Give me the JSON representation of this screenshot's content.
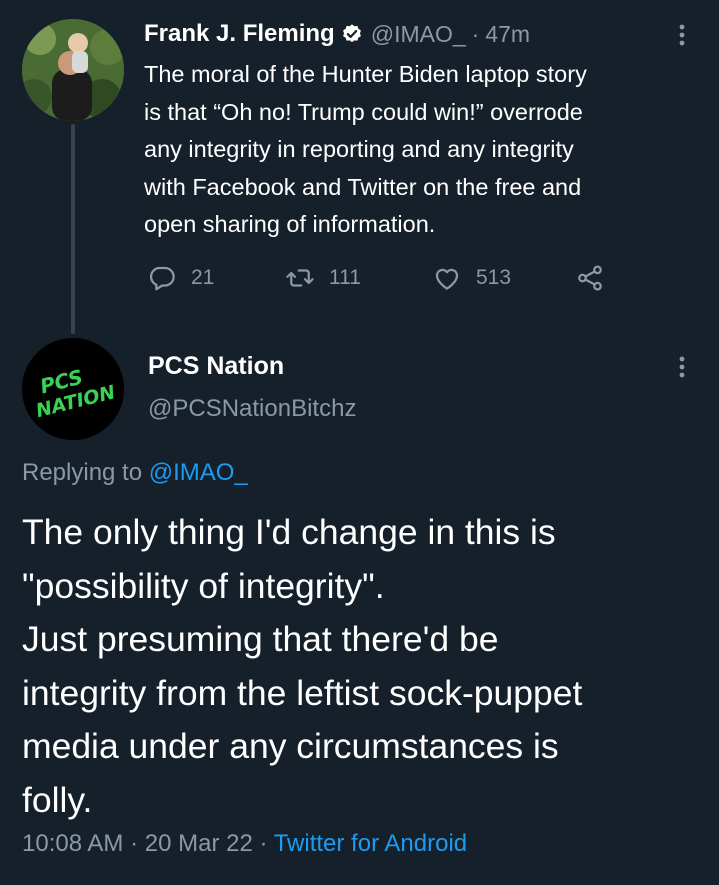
{
  "parent_tweet": {
    "author_name": "Frank J. Fleming",
    "handle": "@IMAO_",
    "separator": "·",
    "time_ago": "47m",
    "text": "The moral of the Hunter Biden laptop story\nis that “Oh no! Trump could win!” overrode\nany integrity in reporting and any integrity\nwith Facebook and Twitter on the free and\nopen sharing of information.",
    "replies": "21",
    "retweets": "111",
    "likes": "513",
    "verified": true
  },
  "reply_tweet": {
    "author_name": "PCS Nation",
    "handle": "@PCSNationBitchz",
    "avatar_text": "PCS NATION",
    "avatar_color": "#39d353",
    "replying_prefix": "Replying to ",
    "replying_to": "@IMAO_",
    "text": "The only thing I'd change in this is\n\"possibility of integrity\".\nJust presuming that there'd be\nintegrity from the leftist sock-puppet\nmedia under any circumstances is\nfolly.",
    "time": "10:08 AM",
    "date": "20 Mar 22",
    "separator": " · ",
    "source": "Twitter for Android"
  },
  "colors": {
    "background": "#15202b",
    "secondary_text": "#8b98a5",
    "link": "#1d9bf0",
    "thread_line": "#38444d"
  },
  "icons": [
    "verified-badge-icon",
    "more-options-icon",
    "reply-icon",
    "retweet-icon",
    "like-icon",
    "share-icon"
  ]
}
